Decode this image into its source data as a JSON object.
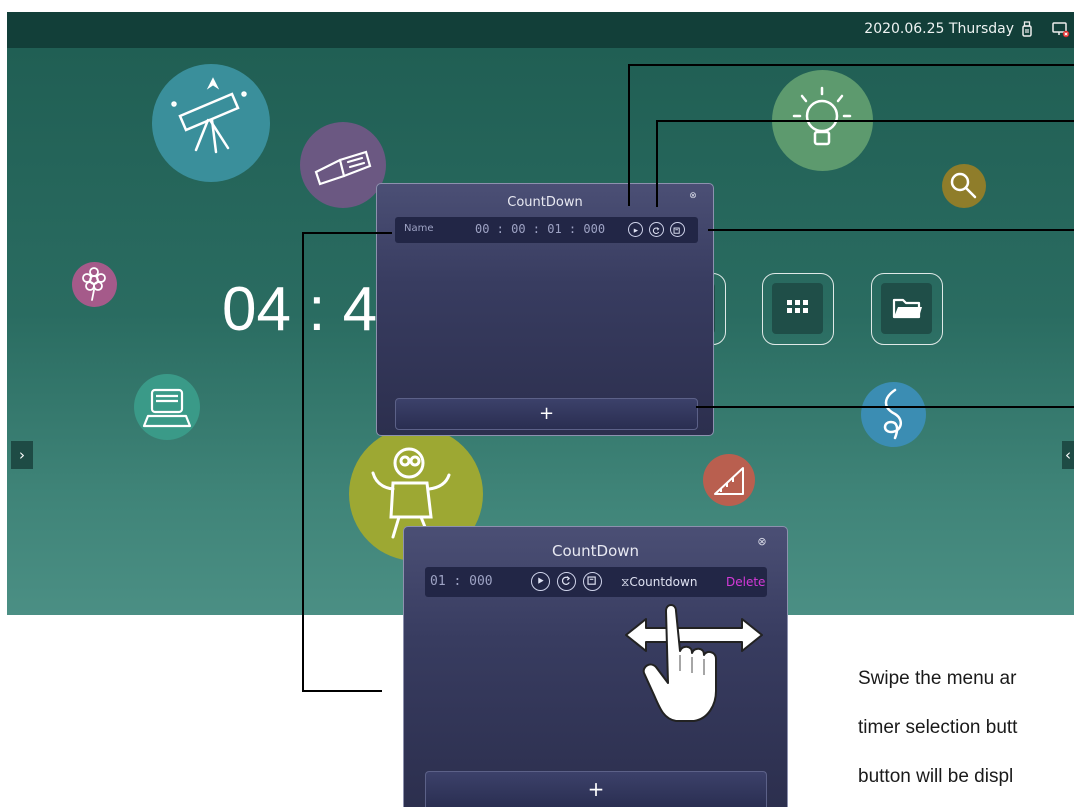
{
  "status_bar": {
    "date_text": "2020.06.25 Thursday",
    "icons": [
      "usb-icon",
      "no-network-icon"
    ]
  },
  "home": {
    "clock_text": "04 : 4",
    "app_buttons": [
      "apps-grid-icon",
      "folder-icon"
    ],
    "bubble_icons": [
      "telescope-icon",
      "book-icon",
      "lightbulb-icon",
      "magnifier-icon",
      "flower-icon",
      "computer-icon",
      "robot-icon",
      "music-note-icon",
      "ruler-icon"
    ],
    "left_arrow": "›",
    "right_arrow": "‹"
  },
  "dialog_top": {
    "title": "CountDown",
    "close_glyph": "⊗",
    "row": {
      "name_label": "Name",
      "time_value": "00 : 00 : 01 : 000",
      "controls": [
        "play-icon",
        "reset-icon",
        "save-icon"
      ]
    },
    "add_label": "+"
  },
  "dialog_bottom": {
    "title": "CountDown",
    "close_glyph": "⊗",
    "row": {
      "time_value": "01 : 000",
      "controls": [
        "play-icon",
        "reset-icon",
        "save-icon"
      ],
      "mode_label": "⧖Countdown",
      "delete_label": "Delete"
    },
    "add_label": "+",
    "gesture": "swipe-hand-icon"
  },
  "caption": {
    "lines": [
      "Swipe the menu ar",
      "timer selection butt",
      "button will be displ"
    ]
  },
  "colors": {
    "delete_text": "#d63ad9",
    "row_text": "#9ea3c4",
    "topbar": "#123f39"
  }
}
